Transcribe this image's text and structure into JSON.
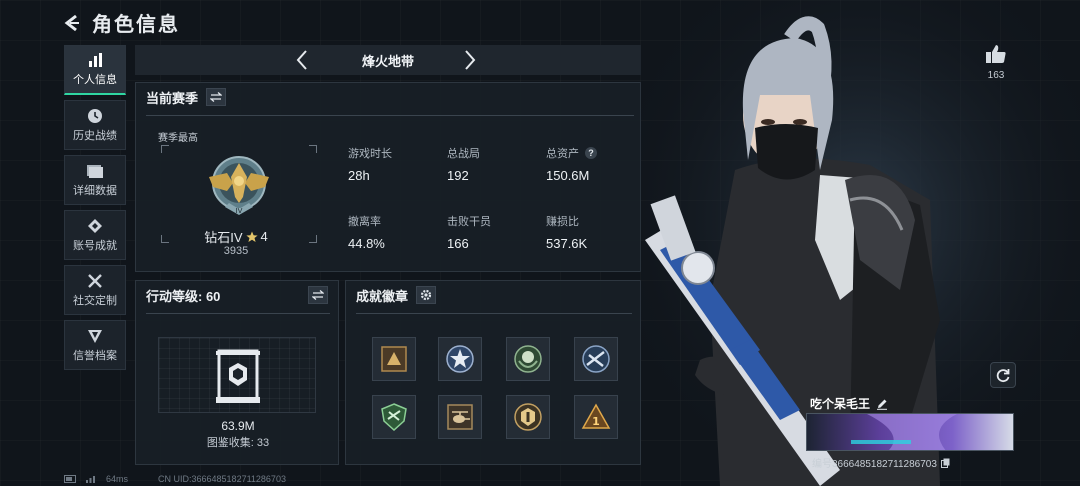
{
  "header": {
    "title": "角色信息",
    "back_icon": "back-arrow-icon"
  },
  "sidebar": {
    "items": [
      {
        "label": "个人信息",
        "icon": "bar-chart-icon",
        "active": true
      },
      {
        "label": "历史战绩",
        "icon": "clock-icon",
        "active": false
      },
      {
        "label": "详细数据",
        "icon": "folder-icon",
        "active": false
      },
      {
        "label": "账号成就",
        "icon": "diamond-icon",
        "active": false
      },
      {
        "label": "社交定制",
        "icon": "tools-icon",
        "active": false
      },
      {
        "label": "信誉档案",
        "icon": "shield-icon",
        "active": false
      }
    ]
  },
  "mode": {
    "name": "烽火地带"
  },
  "season": {
    "title": "当前赛季",
    "best_label": "赛季最高",
    "rank_name": "钻石IV",
    "rank_stars": "4",
    "rank_score": "3935",
    "stats": [
      {
        "key": "游戏时长",
        "value": "28h"
      },
      {
        "key": "总战局",
        "value": "192"
      },
      {
        "key": "总资产",
        "value": "150.6M",
        "help": "?"
      },
      {
        "key": "撤离率",
        "value": "44.8%"
      },
      {
        "key": "击败干员",
        "value": "166"
      },
      {
        "key": "赚损比",
        "value": "537.6K"
      }
    ]
  },
  "level": {
    "title": "行动等级: 60",
    "amount": "63.9M",
    "collection": "图鉴收集: 33"
  },
  "achievements": {
    "title": "成就徽章",
    "badges": [
      "triangle-badge-icon",
      "star-badge-icon",
      "laurel-badge-icon",
      "rifle-badge-icon",
      "shield-badge-icon",
      "helicopter-badge-icon",
      "medal-badge-icon",
      "number-one-badge-icon"
    ]
  },
  "character": {
    "likes": "163",
    "nickname": "吃个呆毛王",
    "player_id": "编号3666485182711286703"
  },
  "footer": {
    "ping": "64ms",
    "uid": "CN UID:3666485182711286703"
  },
  "colors": {
    "accent": "#2fd6a2",
    "panel": "#181f26",
    "bg": "#10151b",
    "gold": "#c9a24a"
  }
}
